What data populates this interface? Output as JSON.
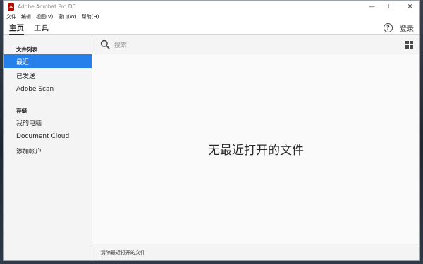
{
  "window": {
    "title": "Adobe Acrobat Pro DC",
    "controls": {
      "minimize": "—",
      "maximize": "☐",
      "close": "✕"
    }
  },
  "menubar": {
    "items": [
      "文件",
      "编辑",
      "视图(V)",
      "窗口(W)",
      "帮助(H)"
    ]
  },
  "tabs": {
    "items": [
      {
        "label": "主页",
        "active": true
      },
      {
        "label": "工具",
        "active": false
      }
    ],
    "help_symbol": "?",
    "login_label": "登录"
  },
  "sidebar": {
    "sections": [
      {
        "header": "文件列表",
        "items": [
          {
            "label": "最近",
            "selected": true
          },
          {
            "label": "已发送",
            "selected": false
          },
          {
            "label": "Adobe Scan",
            "selected": false
          }
        ]
      },
      {
        "header": "存储",
        "items": [
          {
            "label": "我的电脑",
            "selected": false
          },
          {
            "label": "Document Cloud",
            "selected": false
          },
          {
            "label": "添加帐户",
            "selected": false
          }
        ]
      }
    ]
  },
  "search": {
    "placeholder": "搜索"
  },
  "main": {
    "empty_message": "无最近打开的文件"
  },
  "footer": {
    "clear_label": "清除最近打开的文件"
  },
  "colors": {
    "accent": "#2680eb",
    "brand_red": "#b30b00"
  }
}
